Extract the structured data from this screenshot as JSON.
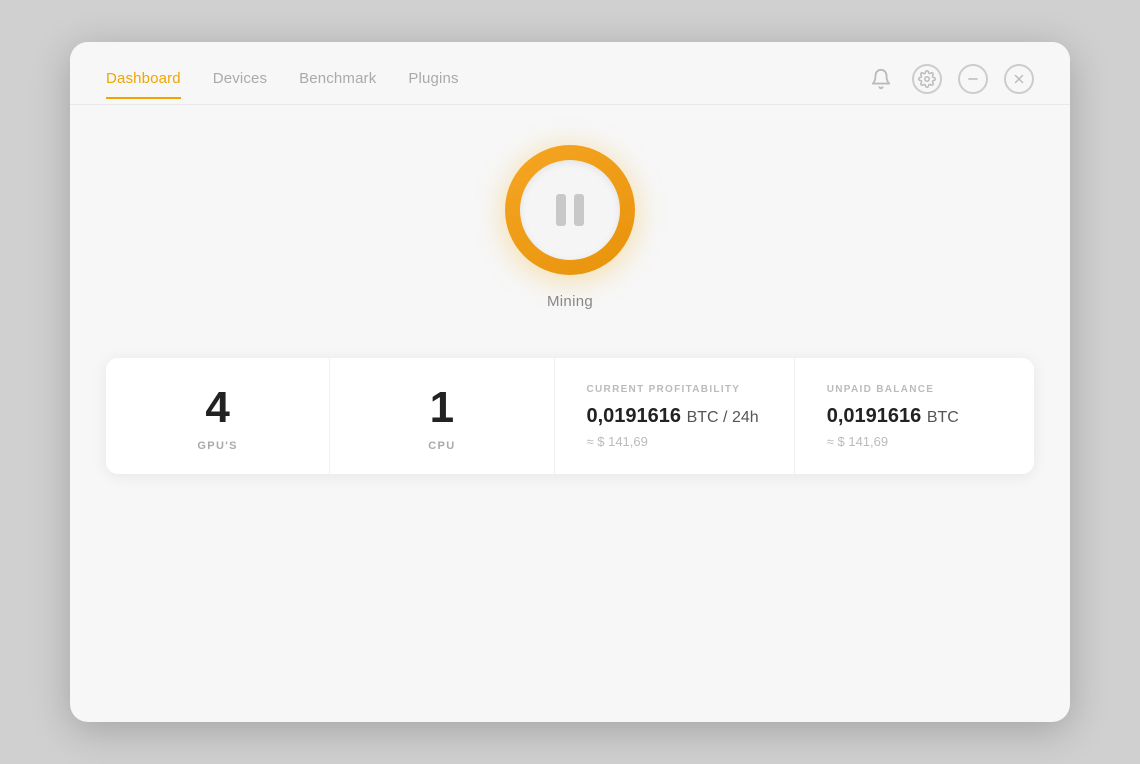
{
  "nav": {
    "items": [
      {
        "label": "Dashboard",
        "active": true
      },
      {
        "label": "Devices",
        "active": false
      },
      {
        "label": "Benchmark",
        "active": false
      },
      {
        "label": "Plugins",
        "active": false
      }
    ],
    "icons": {
      "bell": "🔔",
      "settings": "⚙",
      "minimize": "−",
      "close": "✕"
    }
  },
  "mining": {
    "status_label": "Mining"
  },
  "stats": {
    "gpus": {
      "value": "4",
      "label": "GPU'S"
    },
    "cpu": {
      "value": "1",
      "label": "CPU"
    },
    "profitability": {
      "section_label": "CURRENT PROFITABILITY",
      "btc_value": "0,0191616",
      "btc_unit": "BTC / 24h",
      "usd_approx": "≈ $ 141,69"
    },
    "balance": {
      "section_label": "UNPAID BALANCE",
      "btc_value": "0,0191616",
      "btc_unit": "BTC",
      "usd_approx": "≈ $ 141,69"
    }
  },
  "colors": {
    "accent": "#f0a500",
    "nav_active": "#f0a500"
  }
}
